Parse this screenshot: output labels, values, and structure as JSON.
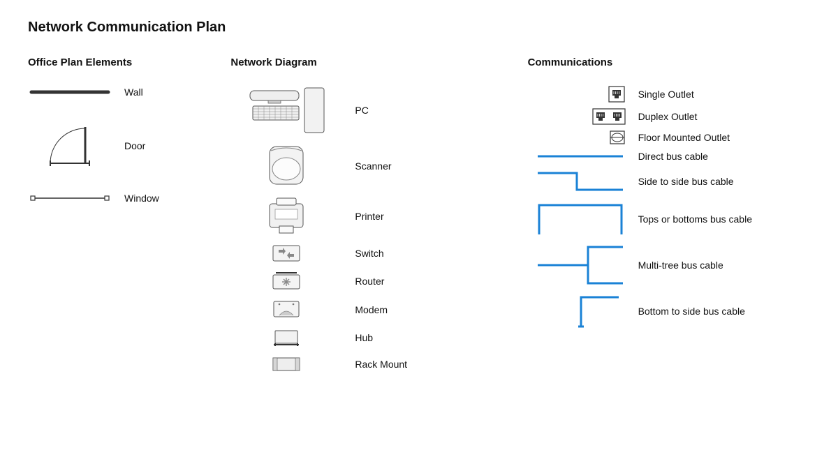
{
  "title": "Network Communication Plan",
  "office": {
    "title": "Office Plan Elements",
    "items": [
      {
        "label": "Wall"
      },
      {
        "label": "Door"
      },
      {
        "label": "Window"
      }
    ]
  },
  "network": {
    "title": "Network Diagram",
    "items": [
      {
        "label": "PC"
      },
      {
        "label": "Scanner"
      },
      {
        "label": "Printer"
      },
      {
        "label": "Switch"
      },
      {
        "label": "Router"
      },
      {
        "label": "Modem"
      },
      {
        "label": "Hub"
      },
      {
        "label": "Rack Mount"
      }
    ]
  },
  "comm": {
    "title": "Communications",
    "items": [
      {
        "label": "Single Outlet"
      },
      {
        "label": "Duplex Outlet"
      },
      {
        "label": "Floor Mounted Outlet"
      },
      {
        "label": "Direct bus cable"
      },
      {
        "label": "Side to side bus cable"
      },
      {
        "label": "Tops or bottoms bus cable"
      },
      {
        "label": "Multi-tree bus cable"
      },
      {
        "label": "Bottom to side bus cable"
      }
    ]
  },
  "colors": {
    "cable": "#1a82d6",
    "stroke": "#222",
    "fill": "#ededed"
  }
}
